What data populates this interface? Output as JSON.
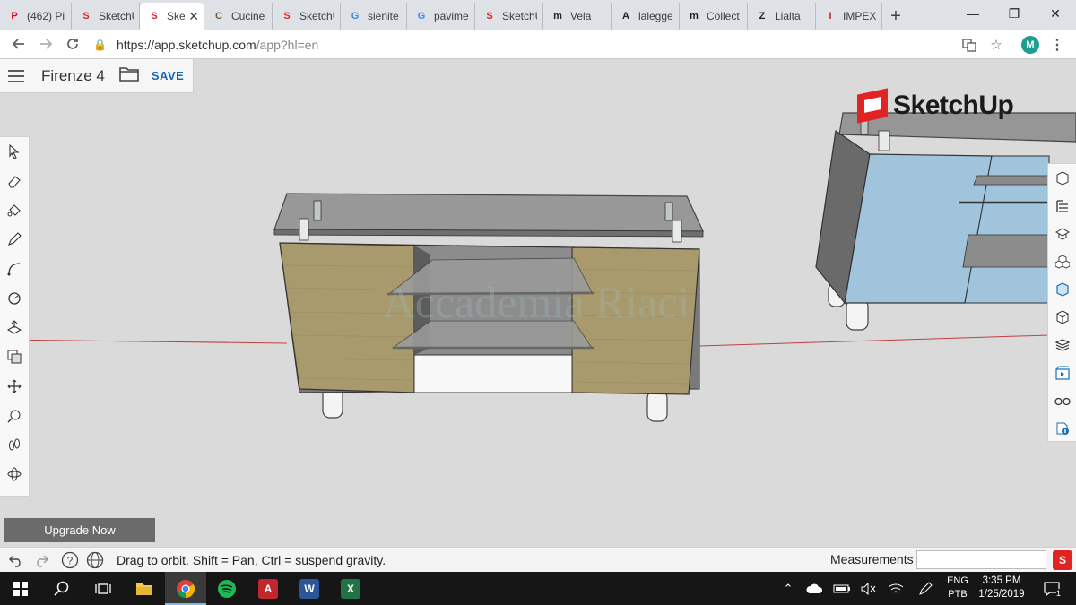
{
  "browser": {
    "tabs": [
      {
        "title": "(462) Pi",
        "fav": "P",
        "favColor": "#e60023"
      },
      {
        "title": "SketchU",
        "fav": "S",
        "favColor": "#e02424"
      },
      {
        "title": "Ske",
        "fav": "S",
        "favColor": "#e02424",
        "active": true
      },
      {
        "title": "Cucine",
        "fav": "C",
        "favColor": "#7a5c3a"
      },
      {
        "title": "SketchU",
        "fav": "S",
        "favColor": "#e02424"
      },
      {
        "title": "sienite",
        "fav": "G",
        "favColor": "#4285f4"
      },
      {
        "title": "pavime",
        "fav": "G",
        "favColor": "#4285f4"
      },
      {
        "title": "SketchU",
        "fav": "S",
        "favColor": "#e02424"
      },
      {
        "title": "Vela",
        "fav": "m",
        "favColor": "#222222"
      },
      {
        "title": "lalegge",
        "fav": "A",
        "favColor": "#222222"
      },
      {
        "title": "Collect",
        "fav": "m",
        "favColor": "#222222"
      },
      {
        "title": "Lialta",
        "fav": "Z",
        "favColor": "#222222"
      },
      {
        "title": "IMPEX",
        "fav": "I",
        "favColor": "#c0282d"
      }
    ],
    "close_glyph": "✕",
    "newtab_glyph": "+",
    "minimize_glyph": "—",
    "restore_glyph": "❐",
    "close_window_glyph": "✕",
    "url_proto": "https://app.sketchup.com",
    "url_rest": "/app?hl=en",
    "avatar_letter": "M"
  },
  "app": {
    "project_name": "Firenze 4",
    "save_label": "SAVE",
    "logo_text": "SketchUp",
    "watermark": "Accademia Riaci",
    "upgrade_label": "Upgrade Now",
    "left_tools": [
      "select",
      "eraser",
      "paint-bucket",
      "pencil",
      "arc",
      "circle",
      "push-pull",
      "offset",
      "move",
      "tape-measure",
      "orbit-walk",
      "orbit"
    ],
    "right_tools": [
      "instructor",
      "outliner",
      "learn",
      "components",
      "materials",
      "styles",
      "layers",
      "scenes",
      "display",
      "model-info"
    ]
  },
  "status": {
    "hint": "Drag to orbit. Shift = Pan, Ctrl = suspend gravity.",
    "measurements_label": "Measurements",
    "measurements_value": ""
  },
  "taskbar": {
    "apps": [
      "start",
      "search",
      "task-view",
      "file-explorer",
      "chrome",
      "spotify",
      "autocad",
      "word",
      "excel"
    ],
    "lang_top": "ENG",
    "lang_bottom": "PTB",
    "time": "3:35 PM",
    "date": "1/25/2019",
    "notif_count": "1"
  },
  "colors": {
    "sketchup_red": "#e02424",
    "save_blue": "#1466b8",
    "wood": "#a89a6c",
    "glass": "#8a8a8a",
    "cabinet_blue": "#9fc4dc"
  }
}
